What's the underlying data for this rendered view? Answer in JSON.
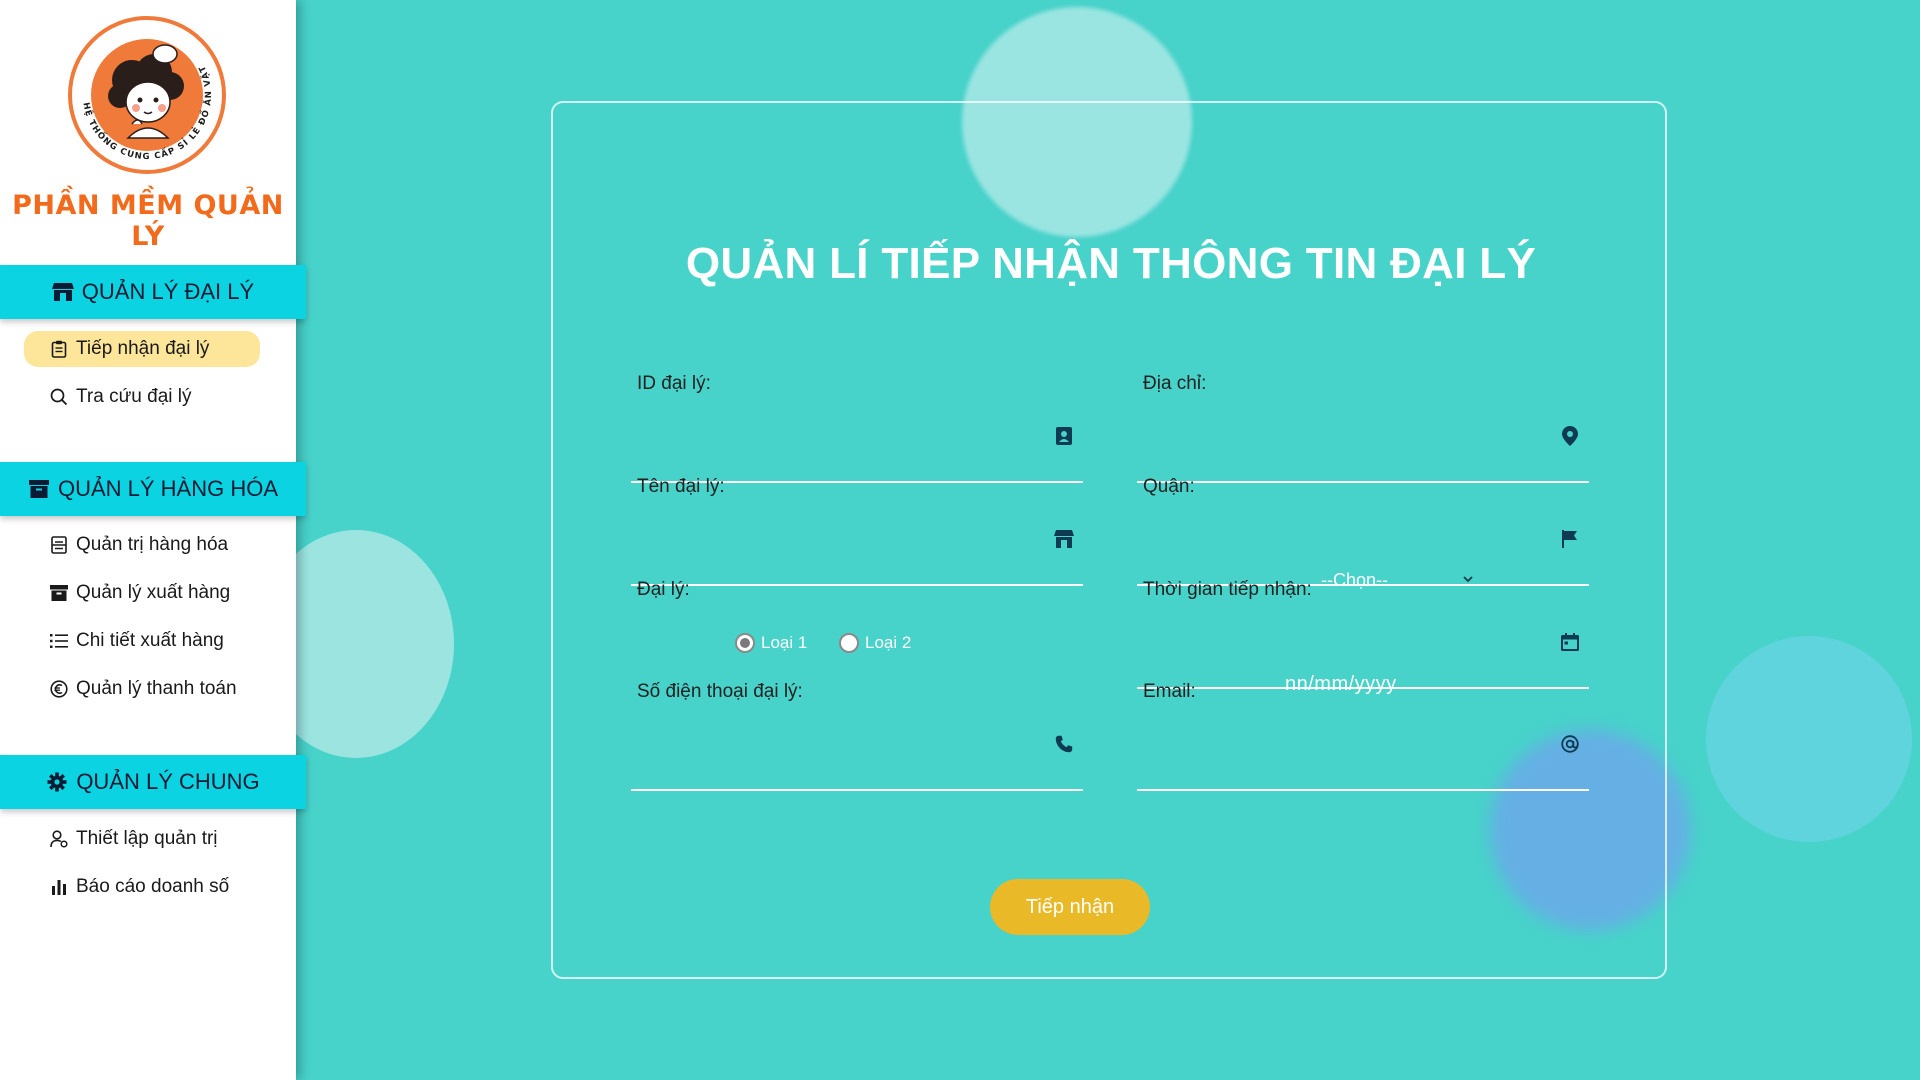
{
  "brand": {
    "title": "PHẦN MỀM QUẢN LÝ",
    "logo_ring_text": "HỆ THỐNG CUNG CẤP SỈ LẺ ĐỒ ĂN VẶT",
    "logo_icon": "chef-girl-logo-icon"
  },
  "sidebar": {
    "sections": [
      {
        "title": "QUẢN LÝ ĐẠI LÝ",
        "icon": "store-icon",
        "items": [
          {
            "label": "Tiếp nhận đại lý",
            "icon": "clipboard-icon",
            "active": true
          },
          {
            "label": "Tra cứu đại lý",
            "icon": "search-icon",
            "active": false
          }
        ]
      },
      {
        "title": "QUẢN LÝ HÀNG HÓA",
        "icon": "archive-icon",
        "items": [
          {
            "label": "Quản trị hàng hóa",
            "icon": "list-box-icon",
            "active": false
          },
          {
            "label": "Quản lý xuất hàng",
            "icon": "archive-icon",
            "active": false
          },
          {
            "label": "Chi tiết xuất hàng",
            "icon": "list-icon",
            "active": false
          },
          {
            "label": "Quản lý thanh toán",
            "icon": "euro-icon",
            "active": false
          }
        ]
      },
      {
        "title": "QUẢN LÝ CHUNG",
        "icon": "gear-icon",
        "items": [
          {
            "label": "Thiết lập quản trị",
            "icon": "user-settings-icon",
            "active": false
          },
          {
            "label": "Báo cáo doanh số",
            "icon": "bar-chart-icon",
            "active": false
          }
        ]
      }
    ]
  },
  "form": {
    "title": "QUẢN LÍ TIẾP NHẬN THÔNG TIN ĐẠI LÝ",
    "fields": {
      "id": {
        "label": "ID đại lý:",
        "value": "",
        "icon": "id-badge-icon"
      },
      "address": {
        "label": "Địa chỉ:",
        "value": "",
        "icon": "map-pin-icon"
      },
      "name": {
        "label": "Tên đại lý:",
        "value": "",
        "icon": "store-icon"
      },
      "district": {
        "label": "Quận:",
        "selected": "--Chọn--",
        "icon": "flag-icon"
      },
      "type": {
        "label": "Đại lý:",
        "options": [
          "Loại 1",
          "Loại 2"
        ],
        "selected": "Loại 1"
      },
      "date": {
        "label": "Thời gian tiếp nhận:",
        "placeholder": "nn/mm/yyyy",
        "icon": "calendar-icon"
      },
      "phone": {
        "label": "Số điện thoại đại lý:",
        "value": "",
        "icon": "phone-icon"
      },
      "email": {
        "label": "Email:",
        "value": "",
        "icon": "at-sign-icon"
      }
    },
    "submit_label": "Tiếp nhận"
  },
  "colors": {
    "background": "#47d2ca",
    "section_header": "#0cd3e2",
    "active_item": "#fde69a",
    "brand_orange": "#f26a1b",
    "submit": "#eab928",
    "icon": "#0f3b52"
  }
}
